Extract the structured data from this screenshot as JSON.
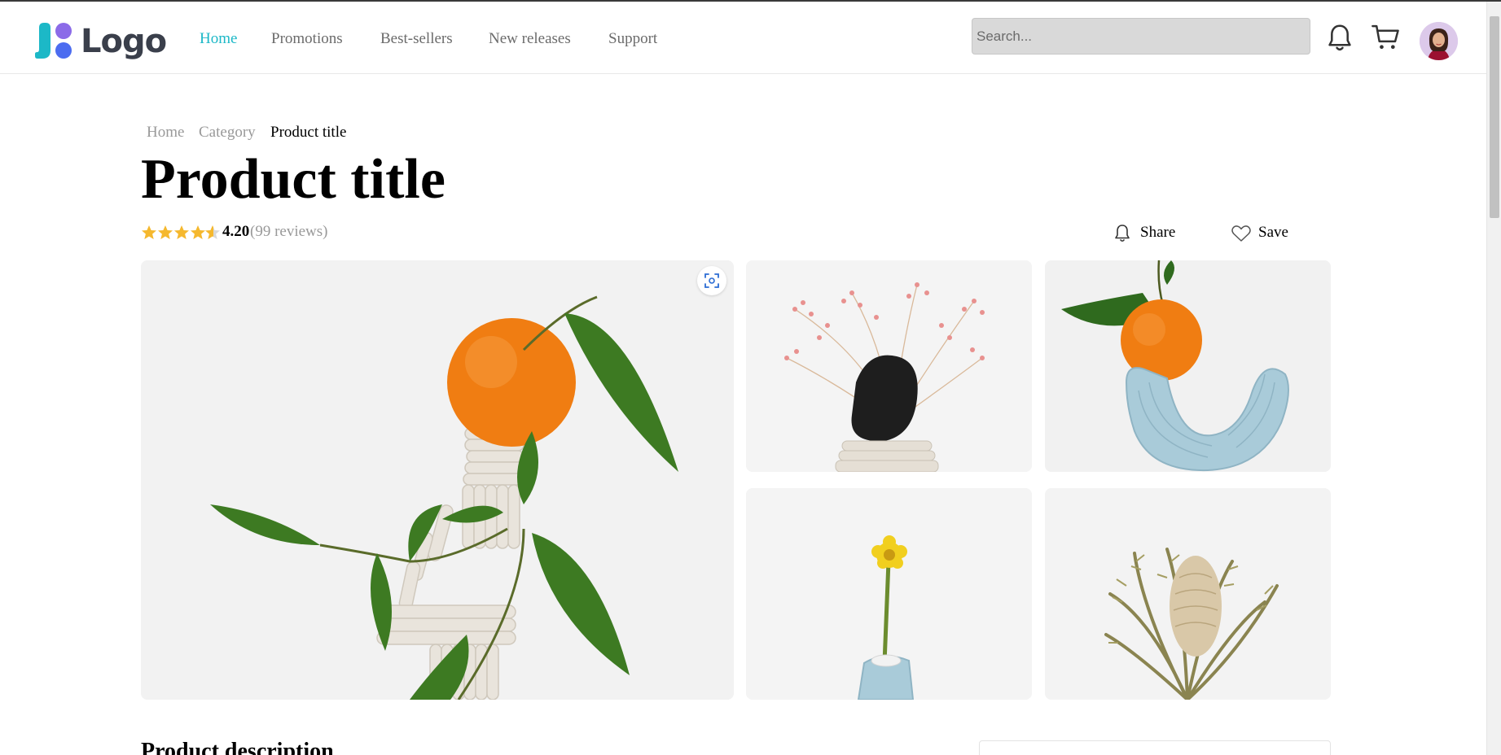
{
  "header": {
    "logo_text": "Logo",
    "nav": [
      {
        "label": "Home",
        "active": true
      },
      {
        "label": "Promotions",
        "active": false
      },
      {
        "label": "Best-sellers",
        "active": false
      },
      {
        "label": "New releases",
        "active": false
      },
      {
        "label": "Support",
        "active": false
      }
    ],
    "search_placeholder": "Search...",
    "icons": [
      "bell-icon",
      "cart-icon",
      "user-avatar"
    ]
  },
  "breadcrumb": {
    "items": [
      "Home",
      "Category"
    ],
    "current": "Product title"
  },
  "product": {
    "title": "Product title",
    "rating_value": "4.20",
    "rating_stars": 4.2,
    "reviews_label": "(99 reviews)"
  },
  "actions": {
    "share_label": "Share",
    "save_label": "Save"
  },
  "gallery": {
    "images": [
      "orange-on-clay-tower",
      "dried-pink-flowers-black-stone",
      "orange-on-blue-clay-arc",
      "yellow-flower-blue-vase",
      "dried-protea-bouquet"
    ]
  },
  "description": {
    "heading": "Product description"
  },
  "colors": {
    "accent": "#1cb8c7",
    "star": "#f5b82e",
    "muted": "#999999"
  }
}
